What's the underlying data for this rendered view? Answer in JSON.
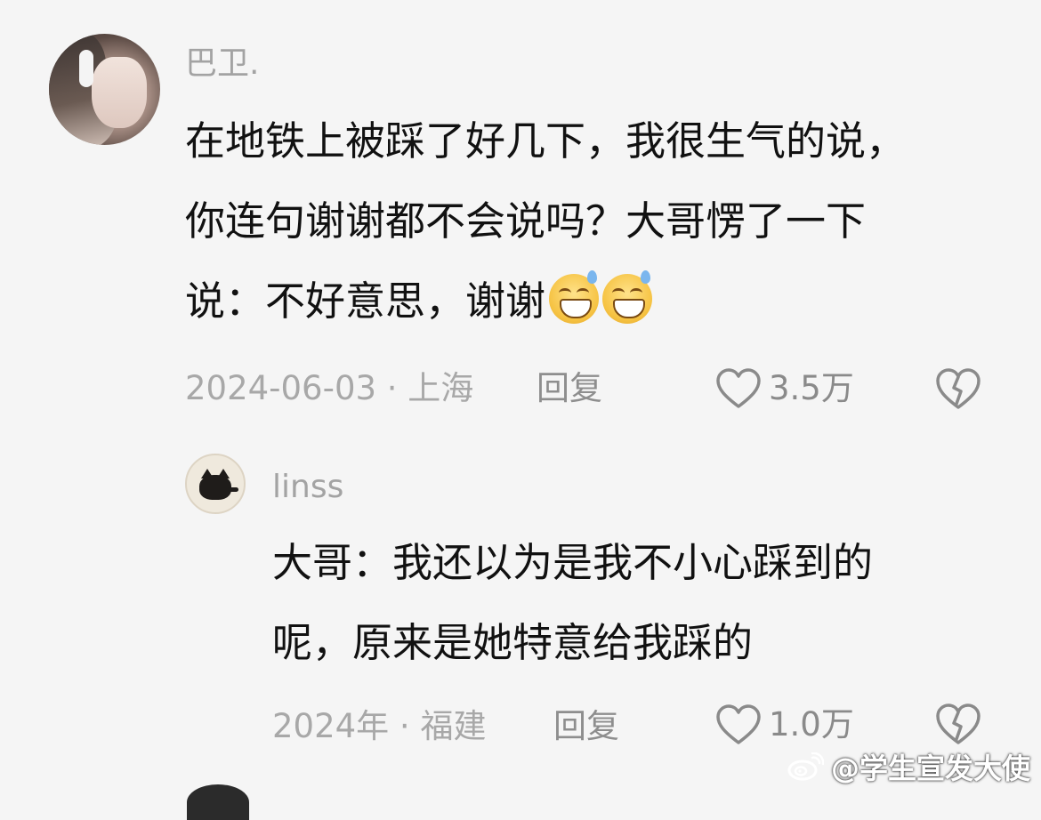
{
  "comment": {
    "username": "巴卫.",
    "lines": [
      "在地铁上被踩了好几下，我很生气的说，",
      "你连句谢谢都不会说吗？大哥愣了一下",
      "说：不好意思，谢谢"
    ],
    "emoji": "grinning-sweat-emoji",
    "date_location": "2024-06-03 · 上海",
    "reply_label": "回复",
    "like_count": "3.5万"
  },
  "reply": {
    "username": "linss",
    "lines": [
      "大哥：我还以为是我不小心踩到的",
      "呢，原来是她特意给我踩的"
    ],
    "date_location": "2024年 · 福建",
    "reply_label": "回复",
    "like_count": "1.0万"
  },
  "watermark": {
    "text": "@学生宣发大使"
  },
  "icons": {
    "like": "heart-outline-icon",
    "dislike": "broken-heart-icon",
    "watermark": "weibo-icon"
  },
  "colors": {
    "background": "#f5f5f5",
    "meta_text": "#a8a8a8",
    "body_text": "#111111"
  }
}
